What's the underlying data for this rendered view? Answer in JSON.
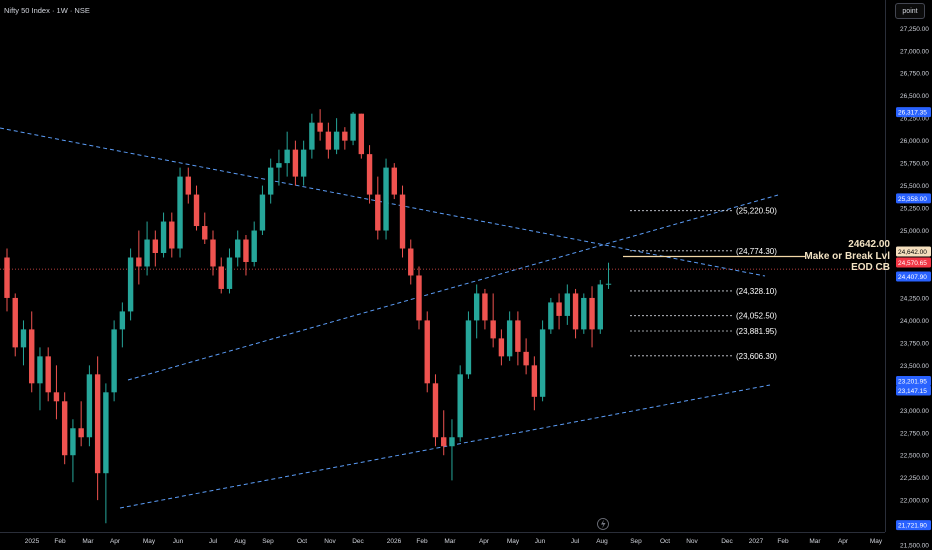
{
  "header": {
    "title": "Nifty 50 Index · 1W · NSE",
    "mode_label": "point"
  },
  "colors": {
    "background": "#000000",
    "up": "#26a69a",
    "down": "#ef5350",
    "trend": "#5b9cf6",
    "level_line": "#f3d8a8",
    "axis_text": "#d1d4dc"
  },
  "annotations": {
    "key_level": "24642.00",
    "make_or_break": "Make or Break Lvl",
    "eod": "EOD CB"
  },
  "chart_data": {
    "type": "candlestick",
    "title": "Nifty 50 Index · 1W · NSE",
    "y_ticks": [
      "27,250.00",
      "27,000.00",
      "26,750.00",
      "26,500.00",
      "26,250.00",
      "26,000.00",
      "25,750.00",
      "25,500.00",
      "25,250.00",
      "25,000.00",
      "24,750.00",
      "24,500.00",
      "24,250.00",
      "24,000.00",
      "23,750.00",
      "23,500.00",
      "23,250.00",
      "23,000.00",
      "22,750.00",
      "22,500.00",
      "22,250.00",
      "22,000.00",
      "21,750.00",
      "21,500.00"
    ],
    "x_labels": [
      "2025",
      "Feb",
      "Mar",
      "Apr",
      "May",
      "Jun",
      "Jul",
      "Aug",
      "Sep",
      "Oct",
      "Nov",
      "Dec",
      "2026",
      "Feb",
      "Mar",
      "Apr",
      "May",
      "Jun",
      "Jul",
      "Aug",
      "Sep",
      "Oct",
      "Nov",
      "Dec",
      "2027",
      "Feb",
      "Mar",
      "Apr",
      "May"
    ],
    "ylim": [
      21450,
      27450
    ],
    "price_tags": [
      {
        "label": "26,317.35",
        "value": 26317.35
      },
      {
        "label": "25,358.00",
        "value": 25358.0
      },
      {
        "label": "24,642.00",
        "value": 24642.0
      },
      {
        "label": "24,570.65",
        "value": 24570.65
      },
      {
        "label": "24,407.90",
        "value": 24407.9
      },
      {
        "label": "23,201.95",
        "value": 23201.95
      },
      {
        "label": "23,147.15",
        "value": 23147.15
      },
      {
        "label": "21,721.90",
        "value": 21721.9
      }
    ],
    "levels": [
      {
        "label": "(25,220.50)",
        "value": 25220.5
      },
      {
        "label": "(24,774.30)",
        "value": 24774.3
      },
      {
        "label": "(24,328.10)",
        "value": 24328.1
      },
      {
        "label": "(24,052.50)",
        "value": 24052.5
      },
      {
        "label": "(23,881.95)",
        "value": 23881.95
      },
      {
        "label": "(23,606.30)",
        "value": 23606.3
      }
    ],
    "candles": [
      [
        24700,
        24800,
        24100,
        24250
      ],
      [
        24250,
        24300,
        23600,
        23700
      ],
      [
        23700,
        24000,
        23500,
        23900
      ],
      [
        23900,
        24100,
        23200,
        23300
      ],
      [
        23300,
        23700,
        23000,
        23600
      ],
      [
        23600,
        23700,
        23100,
        23200
      ],
      [
        23200,
        23500,
        22900,
        23100
      ],
      [
        23100,
        23200,
        22400,
        22500
      ],
      [
        22500,
        22900,
        22200,
        22800
      ],
      [
        22800,
        23100,
        22600,
        22700
      ],
      [
        22700,
        23500,
        22600,
        23400
      ],
      [
        23400,
        23600,
        22000,
        22300
      ],
      [
        22300,
        23300,
        21743,
        23200
      ],
      [
        23200,
        24000,
        23100,
        23900
      ],
      [
        23900,
        24200,
        23700,
        24100
      ],
      [
        24100,
        24800,
        24000,
        24700
      ],
      [
        24700,
        25000,
        24400,
        24600
      ],
      [
        24600,
        25100,
        24500,
        24900
      ],
      [
        24900,
        25000,
        24600,
        24750
      ],
      [
        24750,
        25200,
        24700,
        25100
      ],
      [
        25100,
        25200,
        24700,
        24800
      ],
      [
        24800,
        25700,
        24700,
        25600
      ],
      [
        25600,
        25700,
        25300,
        25400
      ],
      [
        25400,
        25500,
        25000,
        25050
      ],
      [
        25050,
        25200,
        24850,
        24900
      ],
      [
        24900,
        25000,
        24500,
        24600
      ],
      [
        24600,
        24700,
        24300,
        24350
      ],
      [
        24350,
        24800,
        24300,
        24700
      ],
      [
        24700,
        25000,
        24600,
        24900
      ],
      [
        24900,
        24950,
        24500,
        24650
      ],
      [
        24650,
        25100,
        24600,
        25000
      ],
      [
        25000,
        25500,
        24950,
        25400
      ],
      [
        25400,
        25800,
        25300,
        25700
      ],
      [
        25700,
        25900,
        25500,
        25750
      ],
      [
        25750,
        26100,
        25600,
        25900
      ],
      [
        25900,
        26000,
        25500,
        25600
      ],
      [
        25600,
        26000,
        25500,
        25900
      ],
      [
        25900,
        26300,
        25800,
        26200
      ],
      [
        26200,
        26350,
        26000,
        26100
      ],
      [
        26100,
        26200,
        25800,
        25900
      ],
      [
        25900,
        26250,
        25850,
        26100
      ],
      [
        26100,
        26150,
        25900,
        26000
      ],
      [
        26000,
        26317,
        25950,
        26300
      ],
      [
        26300,
        26300,
        25800,
        25850
      ],
      [
        25850,
        25950,
        25300,
        25400
      ],
      [
        25400,
        25600,
        24900,
        25000
      ],
      [
        25000,
        25800,
        24900,
        25700
      ],
      [
        25700,
        25750,
        25350,
        25400
      ],
      [
        25400,
        25500,
        24700,
        24800
      ],
      [
        24800,
        24900,
        24400,
        24500
      ],
      [
        24500,
        24600,
        23900,
        24000
      ],
      [
        24000,
        24100,
        23200,
        23300
      ],
      [
        23300,
        23400,
        22600,
        22700
      ],
      [
        22700,
        23000,
        22500,
        22600
      ],
      [
        22600,
        22900,
        22220,
        22700
      ],
      [
        22700,
        23500,
        22650,
        23400
      ],
      [
        23400,
        24100,
        23350,
        24000
      ],
      [
        24000,
        24400,
        23800,
        24300
      ],
      [
        24300,
        24350,
        23900,
        24000
      ],
      [
        24000,
        24300,
        23700,
        23800
      ],
      [
        23800,
        23900,
        23500,
        23600
      ],
      [
        23600,
        24100,
        23550,
        24000
      ],
      [
        24000,
        24100,
        23500,
        23650
      ],
      [
        23650,
        23800,
        23400,
        23500
      ],
      [
        23500,
        23600,
        23000,
        23150
      ],
      [
        23150,
        24000,
        23100,
        23900
      ],
      [
        23900,
        24250,
        23850,
        24200
      ],
      [
        24200,
        24300,
        23900,
        24050
      ],
      [
        24050,
        24400,
        23950,
        24300
      ],
      [
        24300,
        24350,
        23800,
        23900
      ],
      [
        23900,
        24300,
        23850,
        24250
      ],
      [
        24250,
        24380,
        23700,
        23900
      ],
      [
        23900,
        24450,
        23850,
        24400
      ],
      [
        24400,
        24642,
        24350,
        24408
      ]
    ]
  }
}
